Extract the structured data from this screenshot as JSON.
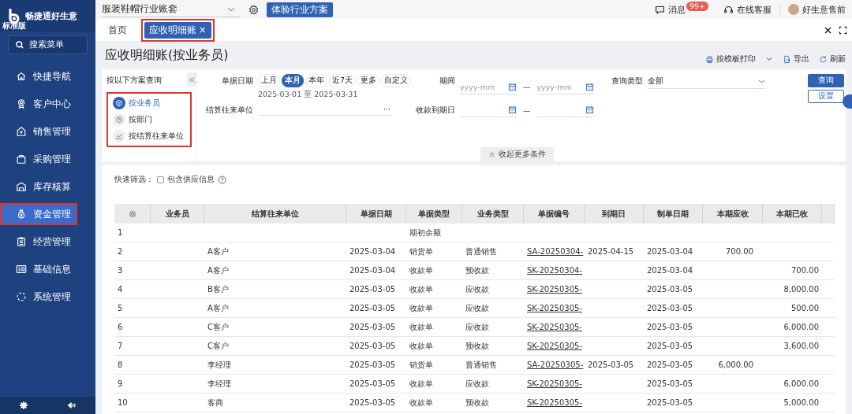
{
  "app": {
    "name": "畅捷通好生意",
    "edition": "标准版"
  },
  "sidebar": {
    "search_placeholder": "搜索菜单",
    "items": [
      {
        "label": "快捷导航",
        "selected": false,
        "highlighted": false
      },
      {
        "label": "客户中心",
        "selected": false,
        "highlighted": false
      },
      {
        "label": "销售管理",
        "selected": false,
        "highlighted": false
      },
      {
        "label": "采购管理",
        "selected": false,
        "highlighted": false
      },
      {
        "label": "库存核算",
        "selected": false,
        "highlighted": false
      },
      {
        "label": "资金管理",
        "selected": true,
        "highlighted": true
      },
      {
        "label": "经营管理",
        "selected": false,
        "highlighted": false
      },
      {
        "label": "基础信息",
        "selected": false,
        "highlighted": false
      },
      {
        "label": "系统管理",
        "selected": false,
        "highlighted": false
      }
    ]
  },
  "top_bar": {
    "account_set": "服装鞋帽行业账套",
    "trial_button": "体验行业方案",
    "messages": {
      "label": "消息",
      "badge": "99+"
    },
    "support": "在线客服",
    "user": "好生意售前"
  },
  "tabs": [
    {
      "label": "首页",
      "selected": false,
      "highlighted": false
    },
    {
      "label": "应收明细账",
      "selected": true,
      "highlighted": true,
      "close_label": "×"
    }
  ],
  "page_title": "应收明细账(按业务员)",
  "toolbar": [
    {
      "kind": "print",
      "label": "按模板打印"
    },
    {
      "kind": "export",
      "label": "导出"
    },
    {
      "kind": "refresh",
      "label": "刷新"
    }
  ],
  "schemes": {
    "title": "按以下方案查询",
    "highlighted": true,
    "items": [
      {
        "label": "按业务员",
        "selected": true
      },
      {
        "label": "按部门",
        "selected": false
      },
      {
        "label": "按结算往来单位",
        "selected": false
      }
    ]
  },
  "filters": {
    "date": {
      "label": "单据日期",
      "presets": [
        {
          "label": "上月",
          "selected": false
        },
        {
          "label": "本月",
          "selected": true
        },
        {
          "label": "本年",
          "selected": false
        },
        {
          "label": "近7天",
          "selected": false
        },
        {
          "label": "更多",
          "selected": false
        },
        {
          "label": "自定义",
          "selected": false
        }
      ],
      "range": "2025-03-01 至 2025-03-31"
    },
    "period": {
      "label": "期间",
      "from_placeholder": "yyyy-mm",
      "to_placeholder": "yyyy-mm",
      "separator": "—"
    },
    "query_type": {
      "label": "查询类型",
      "value": "全部"
    },
    "partner": {
      "label": "结算往来单位",
      "more": "···"
    },
    "due_date": {
      "label": "收款到期日",
      "separator": "—"
    },
    "buttons": [
      {
        "label": "查询",
        "kind": "primary"
      },
      {
        "label": "设置",
        "kind": "outline"
      }
    ],
    "collapse": "收起更多条件"
  },
  "quick_filter": {
    "label": "快速筛选：",
    "checkbox": {
      "label": "包含供应信息",
      "checked": false
    }
  },
  "table": {
    "columns": {
      "salesperson": "业务员",
      "partner": "结算往来单位",
      "date": "单据日期",
      "doc_type": "单据类型",
      "biz_type": "业务类型",
      "doc_no": "单据编号",
      "due_date": "到期日",
      "created": "制单日期",
      "receivable": "本期应收",
      "received": "本期已收"
    },
    "rows": [
      {
        "no": "1",
        "doc_type": "期初余额"
      },
      {
        "no": "2",
        "partner": "A客户",
        "date": "2025-03-04",
        "doc_type": "销货单",
        "biz_type": "普通销售",
        "doc_no": "SA-20250304-",
        "due_date": "2025-04-15",
        "created": "2025-03-04",
        "receivable": "700.00"
      },
      {
        "no": "3",
        "partner": "A客户",
        "date": "2025-03-04",
        "doc_type": "收款单",
        "biz_type": "预收款",
        "doc_no": "SK-20250304-",
        "created": "2025-03-04",
        "received": "700.00"
      },
      {
        "no": "4",
        "partner": "B客户",
        "date": "2025-03-05",
        "doc_type": "收款单",
        "biz_type": "应收款",
        "doc_no": "SK-20250305-",
        "created": "2025-03-05",
        "received": "8,000.00"
      },
      {
        "no": "5",
        "partner": "A客户",
        "date": "2025-03-05",
        "doc_type": "收款单",
        "biz_type": "应收款",
        "doc_no": "SK-20250305-",
        "created": "2025-03-05",
        "received": "500.00"
      },
      {
        "no": "6",
        "partner": "C客户",
        "date": "2025-03-05",
        "doc_type": "收款单",
        "biz_type": "应收款",
        "doc_no": "SK-20250305-",
        "created": "2025-03-05",
        "received": "6,000.00"
      },
      {
        "no": "7",
        "partner": "C客户",
        "date": "2025-03-05",
        "doc_type": "收款单",
        "biz_type": "预收款",
        "doc_no": "SK-20250305-",
        "created": "2025-03-05",
        "received": "3,600.00"
      },
      {
        "no": "8",
        "partner": "李经理",
        "date": "2025-03-05",
        "doc_type": "销货单",
        "biz_type": "普通销售",
        "doc_no": "SA-20250305-",
        "due_date": "2025-03-05",
        "created": "2025-03-05",
        "receivable": "6,000.00"
      },
      {
        "no": "9",
        "partner": "李经理",
        "date": "2025-03-05",
        "doc_type": "收款单",
        "biz_type": "应收款",
        "doc_no": "SK-20250305-",
        "created": "2025-03-05",
        "received": "6,000.00"
      },
      {
        "no": "10",
        "partner": "客商",
        "date": "2025-03-05",
        "doc_type": "收款单",
        "biz_type": "预收款",
        "doc_no": "SK-20250305-",
        "created": "2025-03-05",
        "received": "5,000.00"
      }
    ]
  }
}
